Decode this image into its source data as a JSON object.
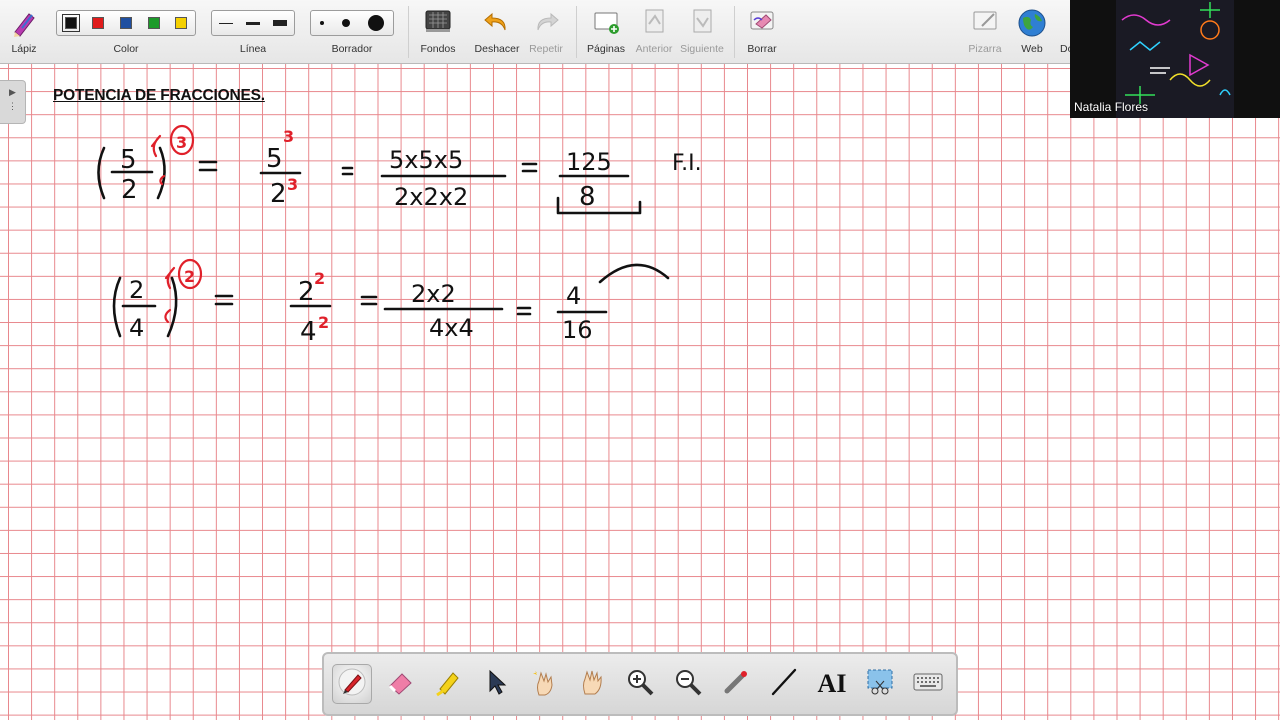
{
  "toolbar": {
    "pencil_label": "Lápiz",
    "color_label": "Color",
    "line_label": "Línea",
    "eraser_label": "Borrador",
    "backgrounds_label": "Fondos",
    "undo_label": "Deshacer",
    "redo_label": "Repetir",
    "pages_label": "Páginas",
    "previous_label": "Anterior",
    "next_label": "Siguiente",
    "clear_label": "Borrar",
    "whiteboard_label": "Pizarra",
    "web_label": "Web",
    "cut_label": "Do",
    "colors": [
      "#111111",
      "#e01b1b",
      "#1f4fa0",
      "#1d9a2a",
      "#f5d000"
    ],
    "selected_color": "#111111"
  },
  "canvas": {
    "title": "POTENCIA DE FRACCIONES.",
    "ink_color": "#111111",
    "accent_ink_color": "#e0202a",
    "grid_color": "#e8878c"
  },
  "handwriting": {
    "row1": {
      "base_num": "5",
      "base_den": "2",
      "exponent": "3",
      "step1_num": "5",
      "step1_num_exp": "3",
      "step1_den": "2",
      "step1_den_exp": "3",
      "step2_num": "5x5x5",
      "step2_den": "2x2x2",
      "result_num": "125",
      "result_den": "8",
      "note": "F.I."
    },
    "row2": {
      "base_num": "2",
      "base_den": "4",
      "exponent": "2",
      "step1_num": "2",
      "step1_num_exp": "2",
      "step1_den": "4",
      "step1_den_exp": "2",
      "step2_num": "2x2",
      "step2_den": "4x4",
      "result_num": "4",
      "result_den": "16"
    }
  },
  "video": {
    "participant_name": "Natalia Flores"
  },
  "bottom_tools": [
    {
      "name": "pen-tool",
      "icon": "pen-icon",
      "active": true
    },
    {
      "name": "eraser-tool",
      "icon": "eraser-icon",
      "active": false
    },
    {
      "name": "highlighter-tool",
      "icon": "highlighter-icon",
      "active": false
    },
    {
      "name": "select-tool",
      "icon": "cursor-arrow-icon",
      "active": false
    },
    {
      "name": "magic-hand-tool",
      "icon": "sparkle-hand-icon",
      "active": false
    },
    {
      "name": "pan-tool",
      "icon": "hand-icon",
      "active": false
    },
    {
      "name": "zoom-in-tool",
      "icon": "zoom-in-icon",
      "active": false
    },
    {
      "name": "zoom-out-tool",
      "icon": "zoom-out-icon",
      "active": false
    },
    {
      "name": "laser-pointer-tool",
      "icon": "laser-pointer-icon",
      "active": false
    },
    {
      "name": "line-tool",
      "icon": "line-icon",
      "active": false
    },
    {
      "name": "text-tool",
      "icon": "text-icon",
      "active": false
    },
    {
      "name": "screen-clip-tool",
      "icon": "screen-clip-icon",
      "active": false
    },
    {
      "name": "keyboard-tool",
      "icon": "keyboard-icon",
      "active": false
    }
  ]
}
